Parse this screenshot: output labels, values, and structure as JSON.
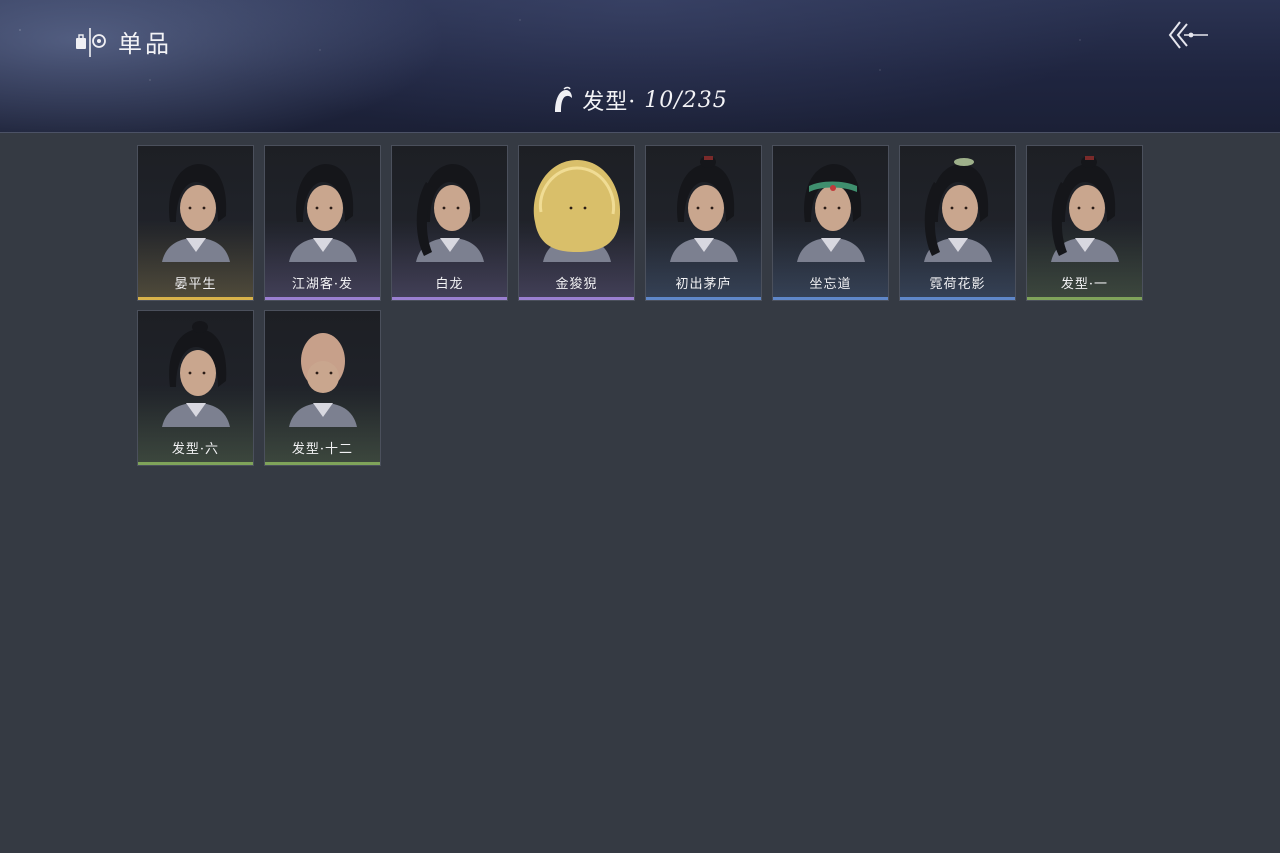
{
  "header": {
    "title": "单品",
    "brand_icon": "wardrobe-mirror-icon",
    "back_icon": "double-chevron-back-icon"
  },
  "category": {
    "icon": "hair-strand-icon",
    "name": "发型·",
    "count": "10/235"
  },
  "items": [
    {
      "label": "晏平生",
      "rarity_color": "#d8b24a",
      "hair": "wavy-dark"
    },
    {
      "label": "江湖客·发",
      "rarity_color": "#9a7fd1",
      "hair": "swept-dark"
    },
    {
      "label": "白龙",
      "rarity_color": "#9a7fd1",
      "hair": "ponytail-dark"
    },
    {
      "label": "金狻猊",
      "rarity_color": "#9a7fd1",
      "hair": "mane-golden"
    },
    {
      "label": "初出茅庐",
      "rarity_color": "#5f87c9",
      "hair": "topknot-dark"
    },
    {
      "label": "坐忘道",
      "rarity_color": "#5f87c9",
      "hair": "headband-green"
    },
    {
      "label": "霓荷花影",
      "rarity_color": "#5f87c9",
      "hair": "ornament-long"
    },
    {
      "label": "发型·一",
      "rarity_color": "#7fa35a",
      "hair": "ponytail-red-tie"
    },
    {
      "label": "发型·六",
      "rarity_color": "#7fa35a",
      "hair": "short-bun"
    },
    {
      "label": "发型·十二",
      "rarity_color": "#7fa35a",
      "hair": "bald"
    }
  ]
}
